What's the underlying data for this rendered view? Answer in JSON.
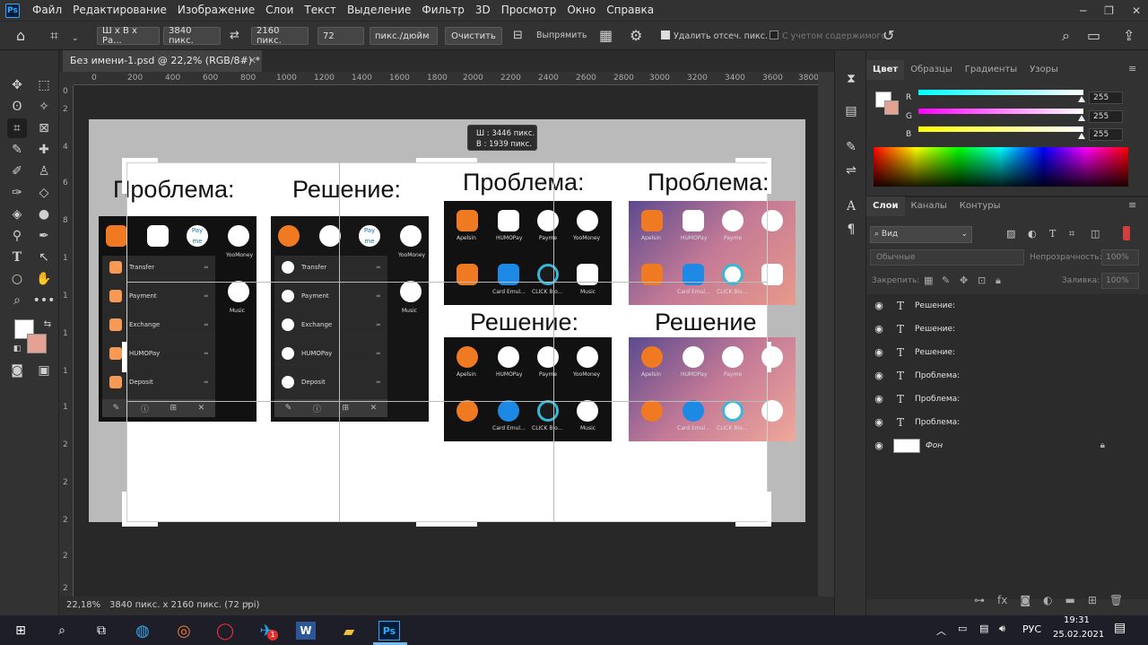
{
  "menu": {
    "logo": "Ps",
    "items": [
      "Файл",
      "Редактирование",
      "Изображение",
      "Слои",
      "Текст",
      "Выделение",
      "Фильтр",
      "3D",
      "Просмотр",
      "Окно",
      "Справка"
    ]
  },
  "options": {
    "ratio": "Ш x В x Ра...",
    "width": "3840 пикс.",
    "height": "2160 пикс.",
    "resolution": "72",
    "units": "пикс./дюйм",
    "clear": "Очистить",
    "straighten": "Выпрямить",
    "delete_cropped": "Удалить отсеч. пикс.",
    "content_aware": "С учетом содержимого"
  },
  "document": {
    "tab_title": "Без имени-1.psd @ 22,2% (RGB/8#) *",
    "ruler_ticks": [
      "0",
      "200",
      "400",
      "600",
      "800",
      "1000",
      "1200",
      "1400",
      "1600",
      "1800",
      "2000",
      "2200",
      "2400",
      "2600",
      "2800",
      "3000",
      "3200",
      "3400",
      "3600",
      "3800"
    ],
    "vruler_ticks": [
      "0",
      "2",
      "4",
      "6",
      "8",
      "1",
      "1",
      "1",
      "1",
      "1",
      "2",
      "2",
      "2",
      "2",
      "2"
    ],
    "tooltip_w": "Ш :  3446 пикс.",
    "tooltip_h": "В :  1939 пикс.",
    "zoom": "22,18%",
    "status": "3840 пикс. x 2160 пикс. (72 ppi)"
  },
  "artwork": {
    "h_problem": "Проблема:",
    "h_solution": "Решение:",
    "h_solution2": "Решение",
    "menu_rows": [
      "Transfer",
      "Payment",
      "Exchange",
      "HUMOPay",
      "Deposit"
    ],
    "app_labels": {
      "apelsin": "Apelsin",
      "humopay": "HUMOPay",
      "payme": "Payme",
      "yoomoney": "YooMoney",
      "card": "Card Emul...",
      "click": "CLICK Bio...",
      "music": "Music",
      "payme_icon": "Pay me"
    }
  },
  "panels": {
    "color_tabs": [
      "Цвет",
      "Образцы",
      "Градиенты",
      "Узоры"
    ],
    "r_label": "R",
    "g_label": "G",
    "b_label": "B",
    "r": "255",
    "g": "255",
    "b": "255",
    "layer_tabs": [
      "Слои",
      "Каналы",
      "Контуры"
    ],
    "filter": "Вид",
    "blend": "Обычные",
    "opacity_label": "Непрозрачность:",
    "opacity": "100%",
    "lock_label": "Закрепить:",
    "fill_label": "Заливка:",
    "fill": "100%",
    "layers": [
      "Решение:",
      "Решение:",
      "Решение:",
      "Проблема:",
      "Проблема:",
      "Проблема:",
      "Фон"
    ]
  },
  "taskbar": {
    "lang": "РУС",
    "time": "19:31",
    "date": "25.02.2021",
    "word": "W",
    "ps": "Ps",
    "telegram_badge": "1"
  },
  "colors": {
    "accent": "#31a8ff",
    "foreground": "#ffffff",
    "background_swatch": "#e3a292"
  }
}
